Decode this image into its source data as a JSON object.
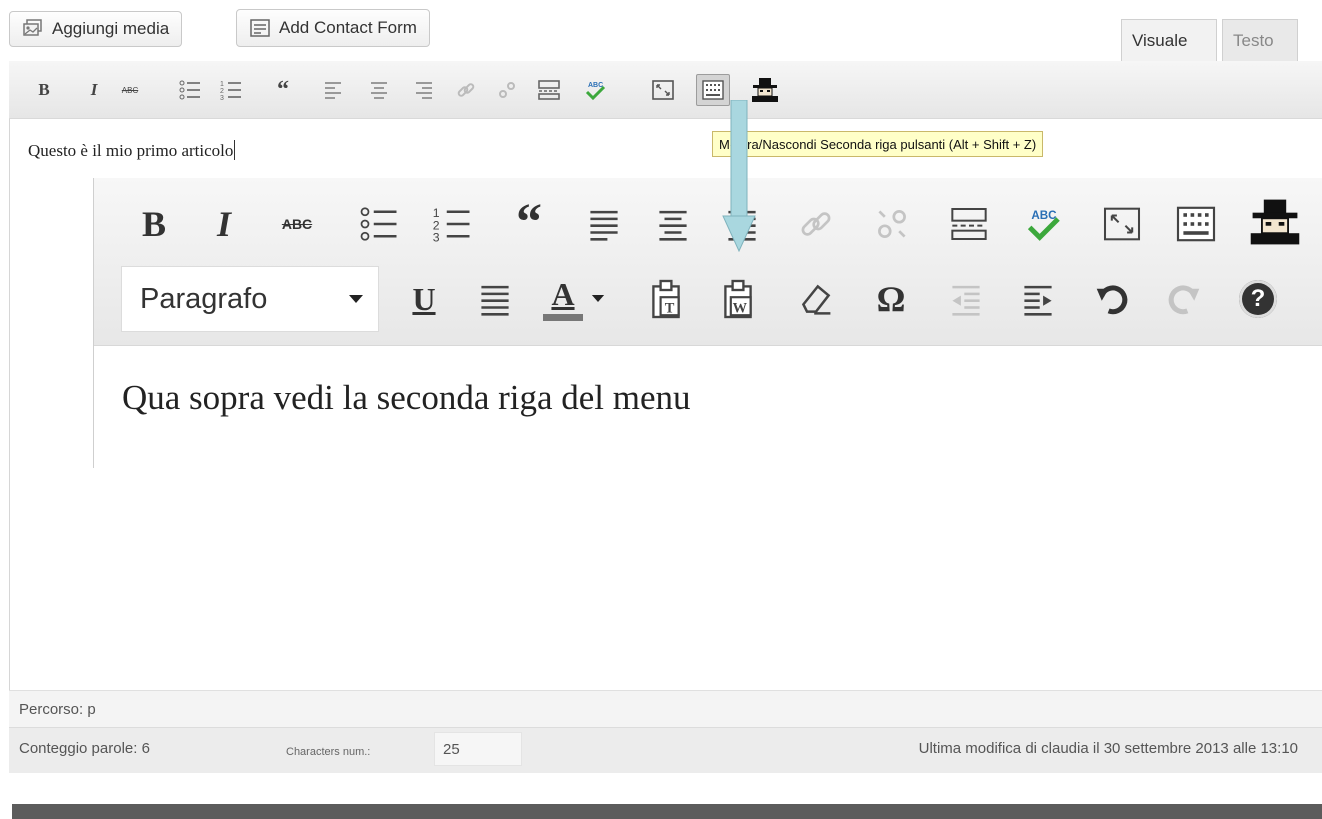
{
  "media_bar": {
    "add_media": "Aggiungi media",
    "add_contact_form": "Add Contact Form"
  },
  "tabs": {
    "visual": "Visuale",
    "text": "Testo"
  },
  "editor": {
    "content": "Questo è il mio primo articolo",
    "tooltip": "Mostra/Nascondi Seconda riga pulsanti (Alt + Shift + Z)"
  },
  "toolbar": {
    "bold": "B",
    "italic": "I",
    "strike": "ABC",
    "blockquote": "“",
    "spellcheck": "ABC",
    "underline": "U",
    "text_color": "A",
    "special_char": "Ω",
    "help": "?",
    "format_select_value": "Paragrafo"
  },
  "zoom": {
    "content": "Qua sopra vedi la seconda riga del menu"
  },
  "footer": {
    "path": "Percorso: p",
    "word_count": "Conteggio parole: 6",
    "chars_label": "Characters num.:",
    "chars_value": "25",
    "last_edit": "Ultima modifica di claudia il 30 settembre 2013 alle 13:10"
  },
  "colors": {
    "tooltip_bg": "#ffffc8",
    "arrow": "#a9d7df",
    "bottom_band": "#5c5c5c"
  }
}
